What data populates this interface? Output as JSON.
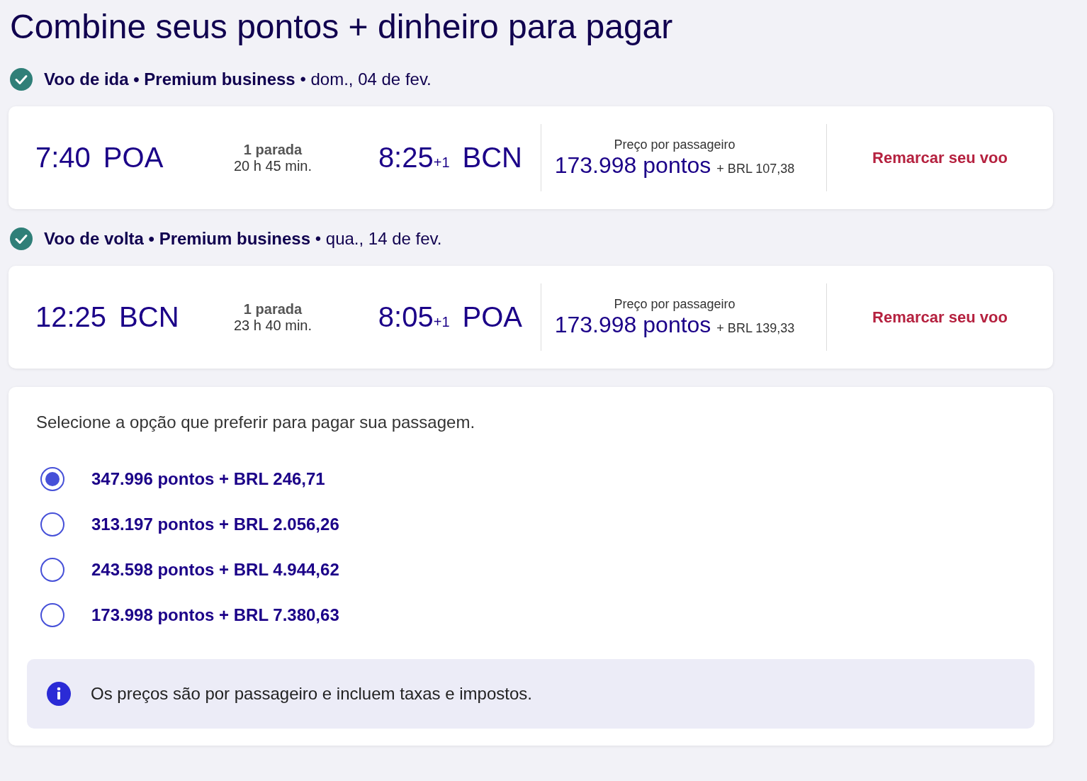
{
  "title": "Combine seus pontos + dinheiro para pagar",
  "flights": [
    {
      "confirmed": true,
      "heading": "**Voo de ida • Premium business** • dom., 04 de fev.",
      "dep_time": "7:40",
      "dep_airport": "POA",
      "stops": "1 parada",
      "duration": "20 h 45 min.",
      "arr_time": "8:25",
      "arr_offset": "+1",
      "arr_airport": "BCN",
      "price_label": "Preço por passageiro",
      "points": "173.998 pontos",
      "cash": "+ BRL 107,38",
      "action": "Remarcar seu voo"
    },
    {
      "confirmed": true,
      "heading": "**Voo de volta • Premium business** • qua., 14 de fev.",
      "dep_time": "12:25",
      "dep_airport": "BCN",
      "stops": "1 parada",
      "duration": "23 h 40 min.",
      "arr_time": "8:05",
      "arr_offset": "+1",
      "arr_airport": "POA",
      "price_label": "Preço por passageiro",
      "points": "173.998 pontos",
      "cash": "+ BRL 139,33",
      "action": "Remarcar seu voo"
    }
  ],
  "payment": {
    "prompt": "Selecione a opção que preferir para pagar sua passagem.",
    "options": [
      {
        "label": "347.996 pontos + BRL 246,71",
        "selected": true
      },
      {
        "label": "313.197 pontos + BRL 2.056,26",
        "selected": false
      },
      {
        "label": "243.598 pontos + BRL 4.944,62",
        "selected": false
      },
      {
        "label": "173.998 pontos + BRL 7.380,63",
        "selected": false
      }
    ],
    "notice": "Os preços são por passageiro e incluem taxas e impostos."
  }
}
